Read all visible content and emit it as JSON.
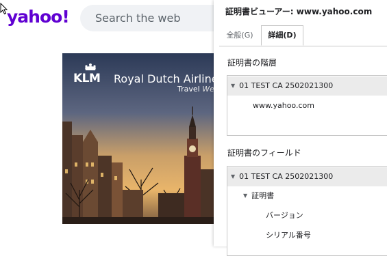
{
  "yahoo": {
    "logo": "yahoo!",
    "search_placeholder": "Search the web"
  },
  "ad": {
    "brand": "KLM",
    "headline": "Royal Dutch Airline",
    "sub_left": "Travel",
    "sub_right": "We"
  },
  "dialog": {
    "title": "証明書ビューアー: www.yahoo.com",
    "tabs": [
      {
        "label": "全般(G)",
        "active": false
      },
      {
        "label": "詳細(D)",
        "active": true
      }
    ],
    "hierarchy_label": "証明書の階層",
    "hierarchy": [
      {
        "label": "01 TEST CA 2502021300",
        "expanded": true
      },
      {
        "label": "www.yahoo.com"
      }
    ],
    "fields_label": "証明書のフィールド",
    "fields": [
      {
        "label": "01 TEST CA 2502021300",
        "expanded": true
      },
      {
        "label": "証明書",
        "expanded": true
      },
      {
        "label": "バージョン"
      },
      {
        "label": "シリアル番号"
      }
    ]
  },
  "colors": {
    "yahoo_purple": "#6001d2",
    "selected_row": "#ebebeb",
    "border": "#c7c7c7"
  }
}
